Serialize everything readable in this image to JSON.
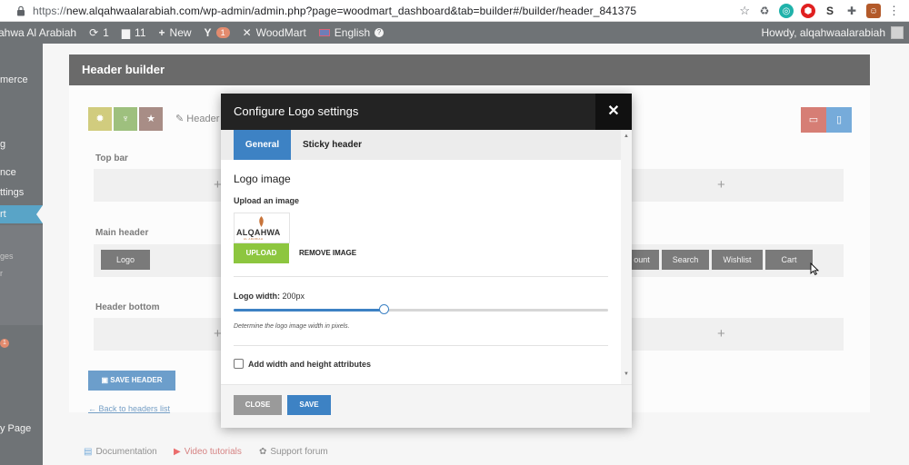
{
  "browser": {
    "url_prefix": "https://",
    "url": "new.alqahwaalarabiah.com/wp-admin/admin.php?page=woodmart_dashboard&tab=builder#/builder/header_841375"
  },
  "adminbar": {
    "site_name": "ahwa Al Arabiah",
    "updates_count": "1",
    "comments_count": "11",
    "new_label": "New",
    "yoast_badge": "1",
    "woodmart_label": "WoodMart",
    "language_label": "English",
    "howdy": "Howdy, alqahwaalarabiah"
  },
  "sidebar": {
    "items": [
      "merce",
      "g",
      "nce",
      "ttings",
      "rt",
      "ges",
      "r",
      "y Page"
    ],
    "badge": "1"
  },
  "builder": {
    "title": "Header builder",
    "header_label": "Header",
    "sections": {
      "top": "Top bar",
      "main": "Main header",
      "bottom": "Header bottom"
    },
    "elements": {
      "logo": "Logo",
      "account": "ount",
      "search": "Search",
      "wishlist": "Wishlist",
      "cart": "Cart"
    },
    "plus": "+",
    "save_header": "SAVE HEADER",
    "back_link": "← Back to headers list",
    "footer": {
      "documentation": "Documentation",
      "video": "Video tutorials",
      "forum": "Support forum"
    }
  },
  "modal": {
    "title": "Configure Logo settings",
    "close_icon": "✕",
    "tabs": [
      "General",
      "Sticky header"
    ],
    "logo_heading": "Logo image",
    "upload_label": "Upload an image",
    "logo_brand": "ALQAHWA",
    "logo_sub": "AL ARABIAH",
    "upload_btn": "UPLOAD",
    "remove_btn": "REMOVE IMAGE",
    "width_label": "Logo width:",
    "width_value": "200px",
    "slider_fraction": 0.4,
    "help": "Determine the logo image width in pixels.",
    "checkbox_label": "Add width and height attributes",
    "footer_close": "CLOSE",
    "footer_save": "SAVE"
  },
  "colors": {
    "accent": "#3d82c4",
    "upload": "#8dc63f",
    "adminbar": "#23282d"
  }
}
